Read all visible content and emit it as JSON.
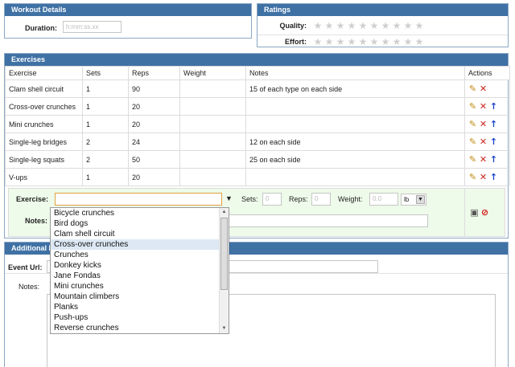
{
  "workout": {
    "title": "Workout Details",
    "duration_label": "Duration:",
    "duration_placeholder": "h:mm:ss.xx"
  },
  "ratings": {
    "title": "Ratings",
    "quality_label": "Quality:",
    "effort_label": "Effort:",
    "star_count": 10,
    "quality_value": 0,
    "effort_value": 0
  },
  "exercises": {
    "title": "Exercises",
    "columns": [
      "Exercise",
      "Sets",
      "Reps",
      "Weight",
      "Notes",
      "Actions"
    ],
    "rows": [
      {
        "exercise": "Clam shell circuit",
        "sets": "1",
        "reps": "90",
        "weight": "",
        "notes": "15 of each type on each side"
      },
      {
        "exercise": "Cross-over crunches",
        "sets": "1",
        "reps": "20",
        "weight": "",
        "notes": ""
      },
      {
        "exercise": "Mini crunches",
        "sets": "1",
        "reps": "20",
        "weight": "",
        "notes": ""
      },
      {
        "exercise": "Single-leg bridges",
        "sets": "2",
        "reps": "24",
        "weight": "",
        "notes": "12 on each side"
      },
      {
        "exercise": "Single-leg squats",
        "sets": "2",
        "reps": "50",
        "weight": "",
        "notes": "25 on each side"
      },
      {
        "exercise": "V-ups",
        "sets": "1",
        "reps": "20",
        "weight": "",
        "notes": ""
      }
    ],
    "add": {
      "exercise_label": "Exercise:",
      "exercise_value": "",
      "sets_label": "Sets:",
      "sets_placeholder": "0",
      "reps_label": "Reps:",
      "reps_placeholder": "0",
      "weight_label": "Weight:",
      "weight_placeholder": "0.0",
      "unit_value": "lb",
      "notes_label": "Notes:"
    }
  },
  "additional": {
    "title": "Additional Info",
    "event_url_label": "Event Url:",
    "notes_label": "Notes:"
  },
  "dropdown": {
    "items": [
      "Bicycle crunches",
      "Bird dogs",
      "Clam shell circuit",
      "Cross-over crunches",
      "Crunches",
      "Donkey kicks",
      "Jane Fondas",
      "Mini crunches",
      "Mountain climbers",
      "Planks",
      "Push-ups",
      "Reverse crunches"
    ],
    "highlighted_index": 3
  }
}
